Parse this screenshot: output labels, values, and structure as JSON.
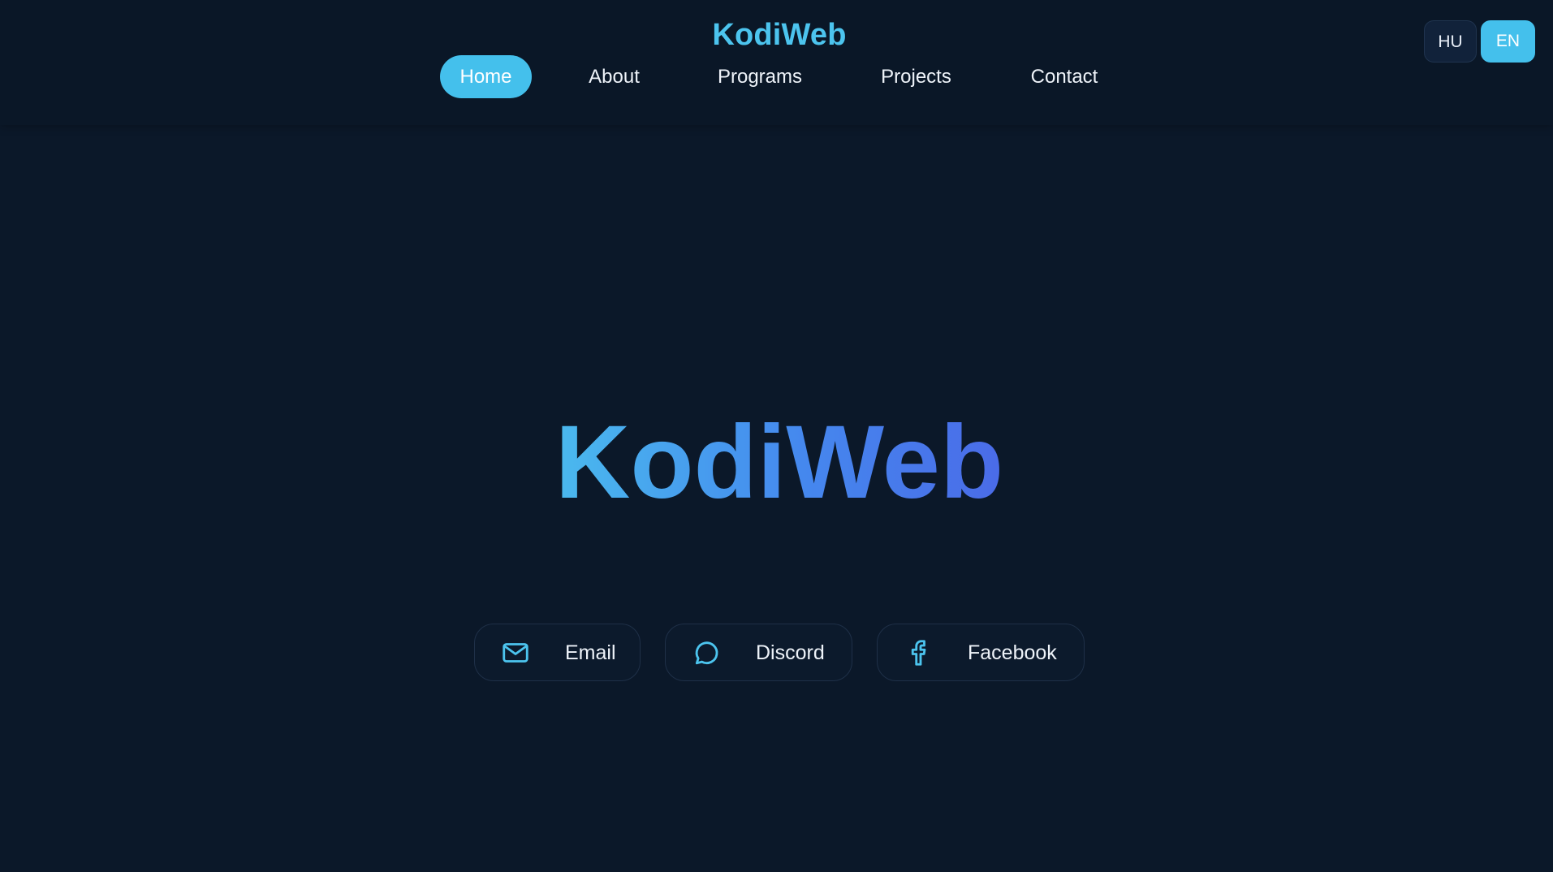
{
  "header": {
    "brand": "KodiWeb",
    "nav": [
      {
        "label": "Home",
        "active": true
      },
      {
        "label": "About",
        "active": false
      },
      {
        "label": "Programs",
        "active": false
      },
      {
        "label": "Projects",
        "active": false
      },
      {
        "label": "Contact",
        "active": false
      }
    ],
    "languages": [
      {
        "code": "HU",
        "selected": false
      },
      {
        "code": "EN",
        "selected": true
      }
    ]
  },
  "hero": {
    "title": "KodiWeb"
  },
  "social": [
    {
      "label": "Email",
      "icon": "mail-icon"
    },
    {
      "label": "Discord",
      "icon": "chat-bubble-icon"
    },
    {
      "label": "Facebook",
      "icon": "facebook-icon"
    }
  ],
  "colors": {
    "background": "#0b1829",
    "accent": "#44c0ec",
    "brand": "#4cc4ee",
    "gradient_start": "#4ab9ee",
    "gradient_end": "#4a6be8"
  }
}
